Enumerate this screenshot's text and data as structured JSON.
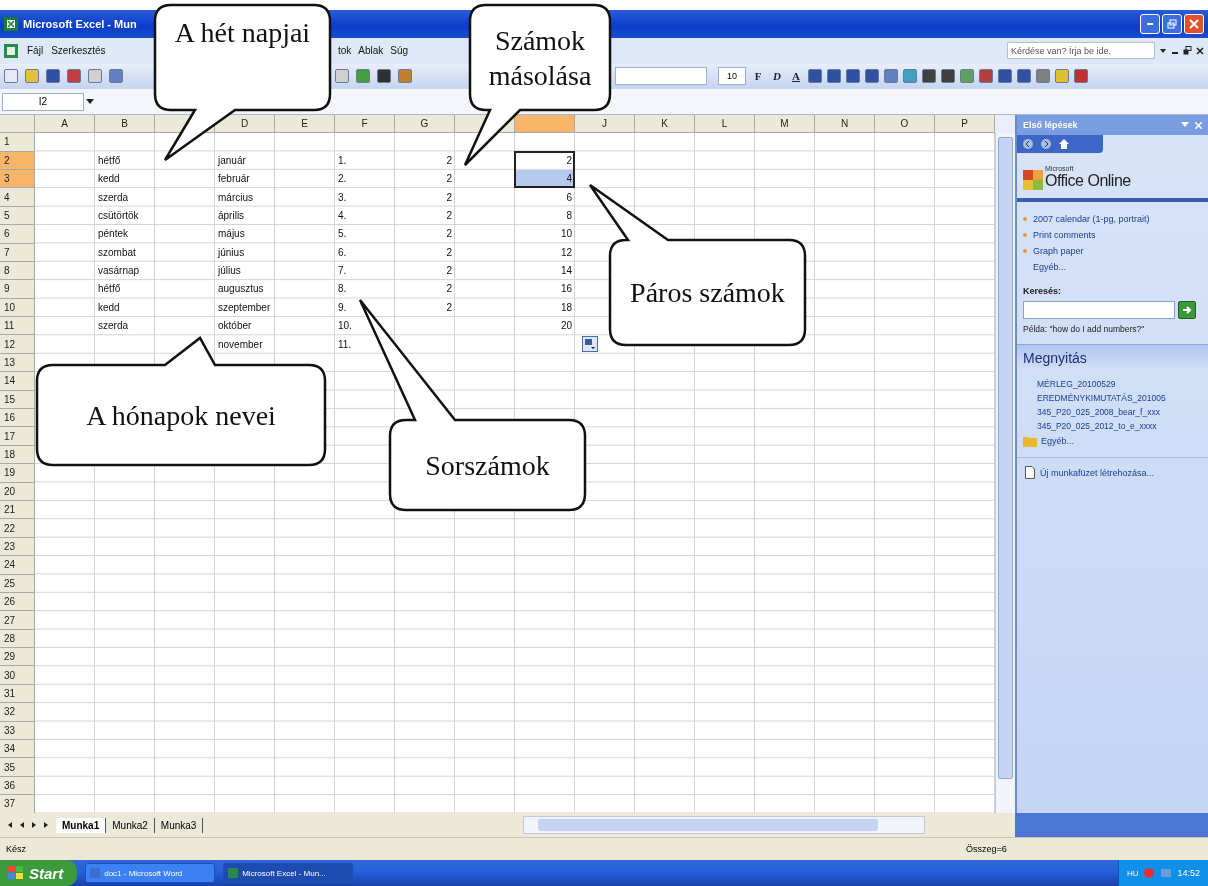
{
  "title_bar": {
    "title": "Microsoft Excel - Mun"
  },
  "menu_bar": {
    "items": [
      "Fájl",
      "Szerkesztés"
    ],
    "items_after_callout": [
      "tok",
      "Ablak",
      "Súg"
    ],
    "help_box": {
      "placeholder": "Kérdése van? Írja be ide."
    }
  },
  "formatting_toolbar": {
    "font_size": "10",
    "bold": "F",
    "italic": "D",
    "underline": "A"
  },
  "formula_bar": {
    "name_box": "I2"
  },
  "sheet": {
    "column_headers": [
      {
        "label": "A",
        "selected": false
      },
      {
        "label": "B",
        "selected": false
      },
      {
        "selected": false
      },
      {
        "label": "D",
        "selected": false
      },
      {
        "label": "E",
        "selected": false
      },
      {
        "label": "F",
        "selected": false
      },
      {
        "label": "G",
        "selected": false
      },
      {
        "selected": false
      },
      {
        "selected": true
      },
      {
        "label": "J",
        "selected": false
      },
      {
        "label": "K",
        "selected": false
      },
      {
        "label": "L",
        "selected": false
      },
      {
        "label": "M",
        "selected": false
      },
      {
        "label": "N",
        "selected": false
      },
      {
        "label": "O",
        "selected": false
      },
      {
        "label": "P",
        "selected": false
      }
    ],
    "rows": [
      {
        "label": "1",
        "selected": false
      },
      {
        "label": "2",
        "selected": true,
        "column_b": "hétfő",
        "column_d": "január",
        "column_f": "1.",
        "column_g": "2",
        "column_i": "2"
      },
      {
        "label": "3",
        "selected": true,
        "column_b": "kedd",
        "column_d": "február",
        "column_f": "2.",
        "column_g": "2",
        "column_i": "4"
      },
      {
        "label": "4",
        "selected": false,
        "column_b": "szerda",
        "column_d": "március",
        "column_f": "3.",
        "column_g": "2",
        "column_i": "6"
      },
      {
        "label": "5",
        "selected": false,
        "column_b": "csütörtök",
        "column_d": "április",
        "column_f": "4.",
        "column_g": "2",
        "column_i": "8"
      },
      {
        "label": "6",
        "selected": false,
        "column_b": "péntek",
        "column_d": "május",
        "column_f": "5.",
        "column_g": "2",
        "column_i": "10"
      },
      {
        "label": "7",
        "selected": false,
        "column_b": "szombat",
        "column_d": "június",
        "column_f": "6.",
        "column_g": "2",
        "column_i": "12"
      },
      {
        "label": "8",
        "selected": false,
        "column_b": "vasárnap",
        "column_d": "július",
        "column_f": "7.",
        "column_g": "2",
        "column_i": "14"
      },
      {
        "label": "9",
        "selected": false,
        "column_b": "hétfő",
        "column_d": "augusztus",
        "column_f": "8.",
        "column_g": "2",
        "column_i": "16"
      },
      {
        "label": "10",
        "selected": false,
        "column_b": "kedd",
        "column_d": "szeptember",
        "column_f": "9.",
        "column_g": "2",
        "column_i": "18"
      },
      {
        "label": "11",
        "selected": false,
        "column_b": "szerda",
        "column_d": "október",
        "column_f": "10.",
        "column_i": "20"
      },
      {
        "label": "12",
        "selected": false,
        "column_d": "november",
        "column_f": "11."
      },
      {
        "label": "13",
        "selected": false
      },
      {
        "label": "14",
        "selected": false
      },
      {
        "label": "15",
        "selected": false
      },
      {
        "label": "16",
        "selected": false
      },
      {
        "label": "17",
        "selected": false
      },
      {
        "label": "18",
        "selected": false
      },
      {
        "label": "19",
        "selected": false
      },
      {
        "label": "20",
        "selected": false
      },
      {
        "label": "21",
        "selected": false
      },
      {
        "label": "22",
        "selected": false
      },
      {
        "label": "23",
        "selected": false
      },
      {
        "label": "24",
        "selected": false
      },
      {
        "label": "25",
        "selected": false
      },
      {
        "label": "26",
        "selected": false
      },
      {
        "label": "27",
        "selected": false
      },
      {
        "label": "28",
        "selected": false
      },
      {
        "label": "29",
        "selected": false
      },
      {
        "label": "30",
        "selected": false
      },
      {
        "label": "31",
        "selected": false
      },
      {
        "label": "32",
        "selected": false
      },
      {
        "label": "33",
        "selected": false
      },
      {
        "label": "34",
        "selected": false
      },
      {
        "label": "35",
        "selected": false
      },
      {
        "label": "36",
        "selected": false
      },
      {
        "label": "37",
        "selected": false
      }
    ]
  },
  "callouts": [
    {
      "text": "A hét napjai"
    },
    {
      "text": "Számok másolása"
    },
    {
      "text": "Páros számok"
    },
    {
      "text": "A hónapok nevei"
    },
    {
      "text": "Sorszámok"
    }
  ],
  "sheet_tabs": [
    {
      "label": "Munka1",
      "selected": true
    },
    {
      "label": "Munka2",
      "selected": false
    },
    {
      "label": "Munka3",
      "selected": false
    }
  ],
  "status_bar": {
    "status": "Kész",
    "sum": "Összeg=6"
  },
  "task_pane": {
    "title": "Első lépések",
    "logo_small": "Microsoft",
    "logo": "Office Online",
    "links": [
      {
        "text": "2007 calendar (1-pg, portrait)",
        "bullet": true
      },
      {
        "text": "Print comments",
        "bullet": true
      },
      {
        "text": "Graph paper",
        "bullet": true
      },
      {
        "text": "Egyéb...",
        "bullet": false
      }
    ],
    "search_label": "Keresés:",
    "example": "Példa: \"how do I add numbers?\"",
    "open_title": "Megnyitás",
    "files": [
      "MÉRLEG_20100529",
      "EREDMÉNYKIMUTATÁS_201005",
      "345_P20_025_2008_bear_f_xxx",
      "345_P20_025_2012_to_e_xxxx"
    ],
    "more": "Egyéb...",
    "new_workbook": "Új munkafüzet létrehozása..."
  },
  "taskbar": {
    "start": "Start",
    "tasks": [
      {
        "label": "doc1 - Microsoft Word",
        "selected": false
      },
      {
        "label": "Microsoft Excel - Mun...",
        "selected": true
      }
    ],
    "language": "HU",
    "clock": "14:52"
  }
}
